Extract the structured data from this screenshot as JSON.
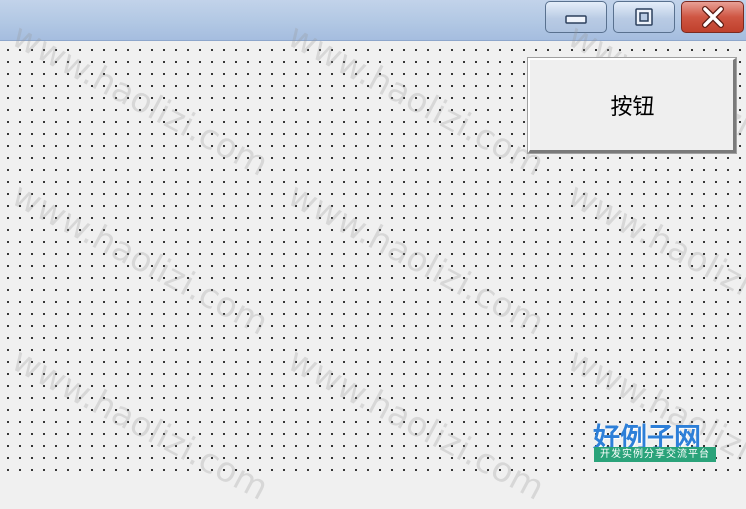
{
  "window": {
    "minimize_icon": "minimize-icon",
    "maximize_icon": "maximize-icon",
    "close_icon": "close-icon"
  },
  "form": {
    "button_label": "按钮"
  },
  "watermark": {
    "text": "www.haolizi.com"
  },
  "logo": {
    "main": "好例子网",
    "tagline": "开发实例分享交流平台"
  },
  "colors": {
    "titlebar": "#b2c8e4",
    "close_button": "#c9503d",
    "canvas": "#f0f0f0",
    "logo_blue": "#2d7fd8",
    "logo_green": "#2aa37a"
  }
}
